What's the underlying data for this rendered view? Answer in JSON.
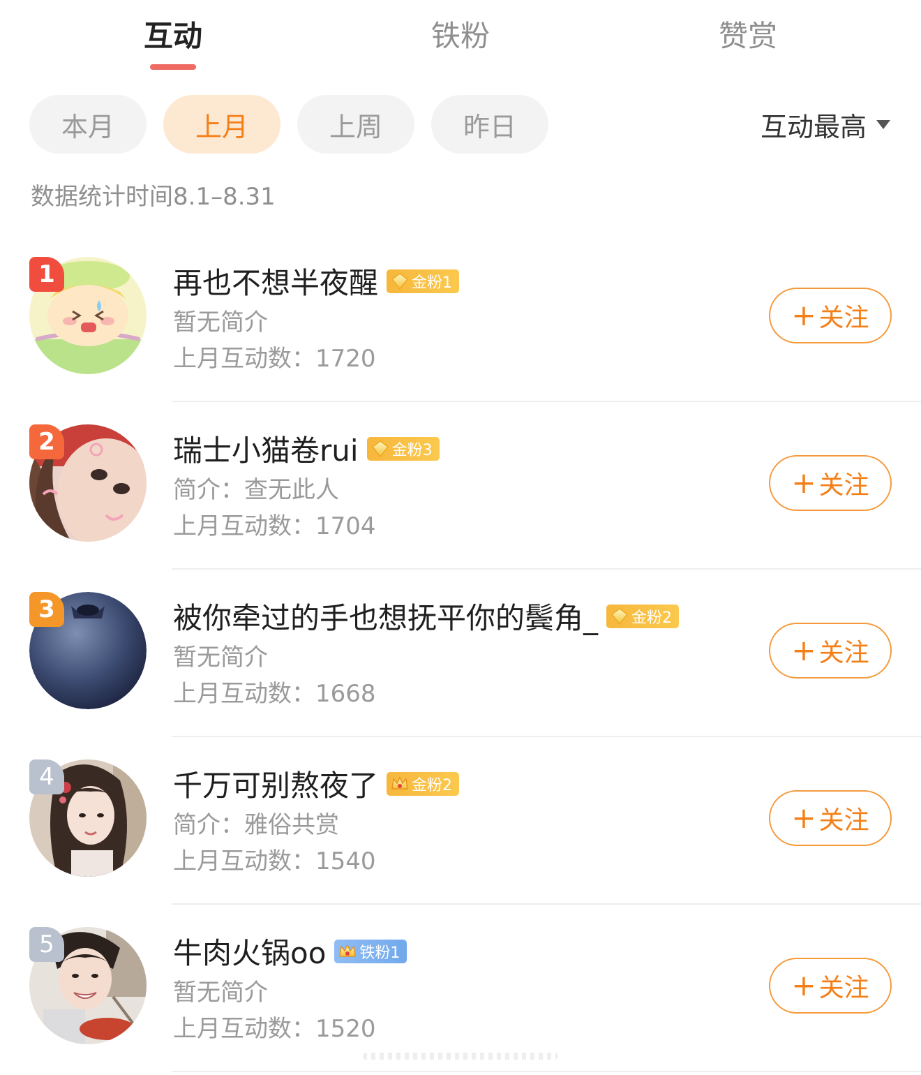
{
  "tabs": [
    {
      "label": "互动",
      "active": true
    },
    {
      "label": "铁粉",
      "active": false
    },
    {
      "label": "赞赏",
      "active": false
    }
  ],
  "filters": {
    "chips": [
      {
        "label": "本月",
        "active": false
      },
      {
        "label": "上月",
        "active": true
      },
      {
        "label": "上周",
        "active": false
      },
      {
        "label": "昨日",
        "active": false
      }
    ],
    "sort_label": "互动最高"
  },
  "stats_period": "数据统计时间8.1–8.31",
  "follow_label": "关注",
  "follow_plus": "+",
  "users": [
    {
      "rank": "1",
      "name": "再也不想半夜醒",
      "badge": "金粉1",
      "badge_type": "gold",
      "bio": "暂无简介",
      "count": "上月互动数：1720",
      "avatar": "cartoon-avatar"
    },
    {
      "rank": "2",
      "name": "瑞士小猫卷rui",
      "badge": "金粉3",
      "badge_type": "gold",
      "bio": "简介：查无此人",
      "count": "上月互动数：1704",
      "avatar": "girl-closeup-avatar"
    },
    {
      "rank": "3",
      "name": "被你牵过的手也想抚平你的鬓角_",
      "badge": "金粉2",
      "badge_type": "gold",
      "bio": "暂无简介",
      "count": "上月互动数：1668",
      "avatar": "blueberry-avatar"
    },
    {
      "rank": "4",
      "name": "千万可别熬夜了",
      "badge": "金粉2",
      "badge_type": "gold-crown",
      "bio": "简介：雅俗共赏",
      "count": "上月互动数：1540",
      "avatar": "girl-portrait-avatar"
    },
    {
      "rank": "5",
      "name": "牛肉火锅oo",
      "badge": "铁粉1",
      "badge_type": "iron-crown",
      "bio": "暂无简介",
      "count": "上月互动数：1520",
      "avatar": "boy-eating-avatar"
    }
  ],
  "colors": {
    "accent": "#f57f17",
    "tab_underline": "#ee6a62",
    "chip_active_bg": "#fde8d2"
  }
}
